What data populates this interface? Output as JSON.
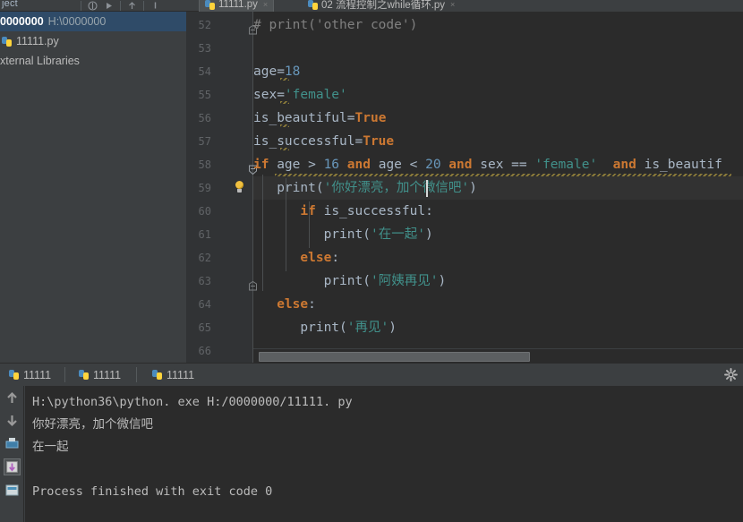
{
  "window": {
    "theme_bg": "#3c3f41",
    "editor_bg": "#2b2b2b",
    "selection_bg": "#2f4b68",
    "keyword_color": "#cc7832",
    "string_color": "#6a8759",
    "number_color": "#6897bb"
  },
  "toolbar": {
    "left_label": "ject",
    "icons": [
      {
        "name": "navigate-icon",
        "glyph": "⯆"
      },
      {
        "name": "run-icon",
        "glyph": "▶"
      },
      {
        "name": "debug-icon",
        "glyph": "⚙"
      },
      {
        "name": "coverage-icon",
        "glyph": "▣"
      },
      {
        "name": "update-project-icon",
        "glyph": "⬇"
      },
      {
        "name": "commit-icon",
        "glyph": "⬆"
      }
    ]
  },
  "editor_tabs": [
    {
      "name": "tab-11111",
      "label": "11111.py",
      "active": true,
      "icon": "python-file-icon",
      "close": "×"
    },
    {
      "name": "tab-while-loop",
      "label": "02 流程控制之while循环.py",
      "active": false,
      "icon": "python-file-icon",
      "close": "×"
    }
  ],
  "project_tree": {
    "title": "Project",
    "items": [
      {
        "name": "project-root-0000000",
        "label": "0000000",
        "path": "H:\\0000000",
        "selected": true,
        "icon": "folder-icon"
      },
      {
        "name": "file-11111-py",
        "label": "11111.py",
        "path": "",
        "selected": false,
        "icon": "python-file-icon"
      },
      {
        "name": "external-libraries-node",
        "label": "xternal Libraries",
        "path": "",
        "selected": false,
        "icon": "library-icon"
      }
    ]
  },
  "code": {
    "first_line_number": 52,
    "lines": [
      {
        "n": 52,
        "tokens": [
          {
            "t": "# print('other code')",
            "c": "cmt"
          }
        ],
        "fold": "end",
        "indent": 0
      },
      {
        "n": 53,
        "tokens": [],
        "indent": 0
      },
      {
        "n": 54,
        "tokens": [
          {
            "t": "age=",
            "c": "op"
          },
          {
            "t": "18",
            "c": "num"
          }
        ],
        "indent": 0
      },
      {
        "n": 55,
        "tokens": [
          {
            "t": "sex=",
            "c": "op"
          },
          {
            "t": "'female'",
            "c": "str-cn"
          }
        ],
        "indent": 0
      },
      {
        "n": 56,
        "tokens": [
          {
            "t": "is_beautiful=",
            "c": "op"
          },
          {
            "t": "True",
            "c": "kw"
          }
        ],
        "indent": 0
      },
      {
        "n": 57,
        "tokens": [
          {
            "t": "is_successful=",
            "c": "op"
          },
          {
            "t": "True",
            "c": "kw"
          }
        ],
        "indent": 0
      },
      {
        "n": 58,
        "tokens": [
          {
            "t": "if",
            "c": "kw"
          },
          {
            "t": " age > ",
            "c": "op"
          },
          {
            "t": "16",
            "c": "num"
          },
          {
            "t": " ",
            "c": "op"
          },
          {
            "t": "and",
            "c": "kw"
          },
          {
            "t": " age < ",
            "c": "op"
          },
          {
            "t": "20",
            "c": "num"
          },
          {
            "t": " ",
            "c": "op"
          },
          {
            "t": "and",
            "c": "kw"
          },
          {
            "t": " sex == ",
            "c": "op"
          },
          {
            "t": "'female'",
            "c": "str-cn"
          },
          {
            "t": "  ",
            "c": "op"
          },
          {
            "t": "and",
            "c": "kw"
          },
          {
            "t": " is_beautif",
            "c": "op"
          }
        ],
        "fold": "start",
        "indent": 0
      },
      {
        "n": 59,
        "tokens": [
          {
            "t": "print(",
            "c": "op"
          },
          {
            "t": "'你好漂亮，加个微信吧'",
            "c": "str-cn"
          },
          {
            "t": ")",
            "c": "op"
          }
        ],
        "indent": 1,
        "bulb": true,
        "highlight": true,
        "caret_after": "'你好漂亮，"
      },
      {
        "n": 60,
        "tokens": [
          {
            "t": "if",
            "c": "kw"
          },
          {
            "t": " is_successful:",
            "c": "op"
          }
        ],
        "indent": 2
      },
      {
        "n": 61,
        "tokens": [
          {
            "t": "print(",
            "c": "op"
          },
          {
            "t": "'在一起'",
            "c": "str-cn"
          },
          {
            "t": ")",
            "c": "op"
          }
        ],
        "indent": 3
      },
      {
        "n": 62,
        "tokens": [
          {
            "t": "else",
            "c": "kw"
          },
          {
            "t": ":",
            "c": "op"
          }
        ],
        "indent": 2
      },
      {
        "n": 63,
        "tokens": [
          {
            "t": "print(",
            "c": "op"
          },
          {
            "t": "'阿姨再见'",
            "c": "str-cn"
          },
          {
            "t": ")",
            "c": "op"
          }
        ],
        "indent": 3,
        "fold": "end"
      },
      {
        "n": 64,
        "tokens": [
          {
            "t": "else",
            "c": "kw"
          },
          {
            "t": ":",
            "c": "op"
          }
        ],
        "indent": 1
      },
      {
        "n": 65,
        "tokens": [
          {
            "t": "print(",
            "c": "op"
          },
          {
            "t": "'再见'",
            "c": "str-cn"
          },
          {
            "t": ")",
            "c": "op"
          }
        ],
        "indent": 2
      },
      {
        "n": 66,
        "tokens": [],
        "indent": 0
      }
    ]
  },
  "run_window": {
    "tabs": [
      {
        "name": "run-tab-11111-a",
        "label": "11111",
        "active": false,
        "icon": "python-run-icon"
      },
      {
        "name": "run-tab-11111-b",
        "label": "11111",
        "active": false,
        "icon": "python-run-icon"
      },
      {
        "name": "run-tab-11111-c",
        "label": "11111",
        "active": false,
        "icon": "python-run-icon"
      }
    ],
    "settings_icon": "gear-icon",
    "side_buttons": [
      {
        "name": "rerun-up-icon",
        "glyph": "↑",
        "selected": false
      },
      {
        "name": "scroll-down-icon",
        "glyph": "↓",
        "selected": false
      },
      {
        "name": "print-icon",
        "glyph": "⎙",
        "selected": false
      },
      {
        "name": "soft-wrap-icon",
        "glyph": "↵",
        "selected": true
      },
      {
        "name": "use-console-icon",
        "glyph": "⌨",
        "selected": false
      }
    ],
    "console_lines": [
      {
        "text": "H:\\python36\\python. exe H:/0000000/11111. py",
        "cn": false
      },
      {
        "text": "你好漂亮，加个微信吧",
        "cn": true
      },
      {
        "text": "在一起",
        "cn": true
      },
      {
        "text": "",
        "cn": false
      },
      {
        "text": "Process finished with exit code 0",
        "cn": false
      }
    ]
  }
}
